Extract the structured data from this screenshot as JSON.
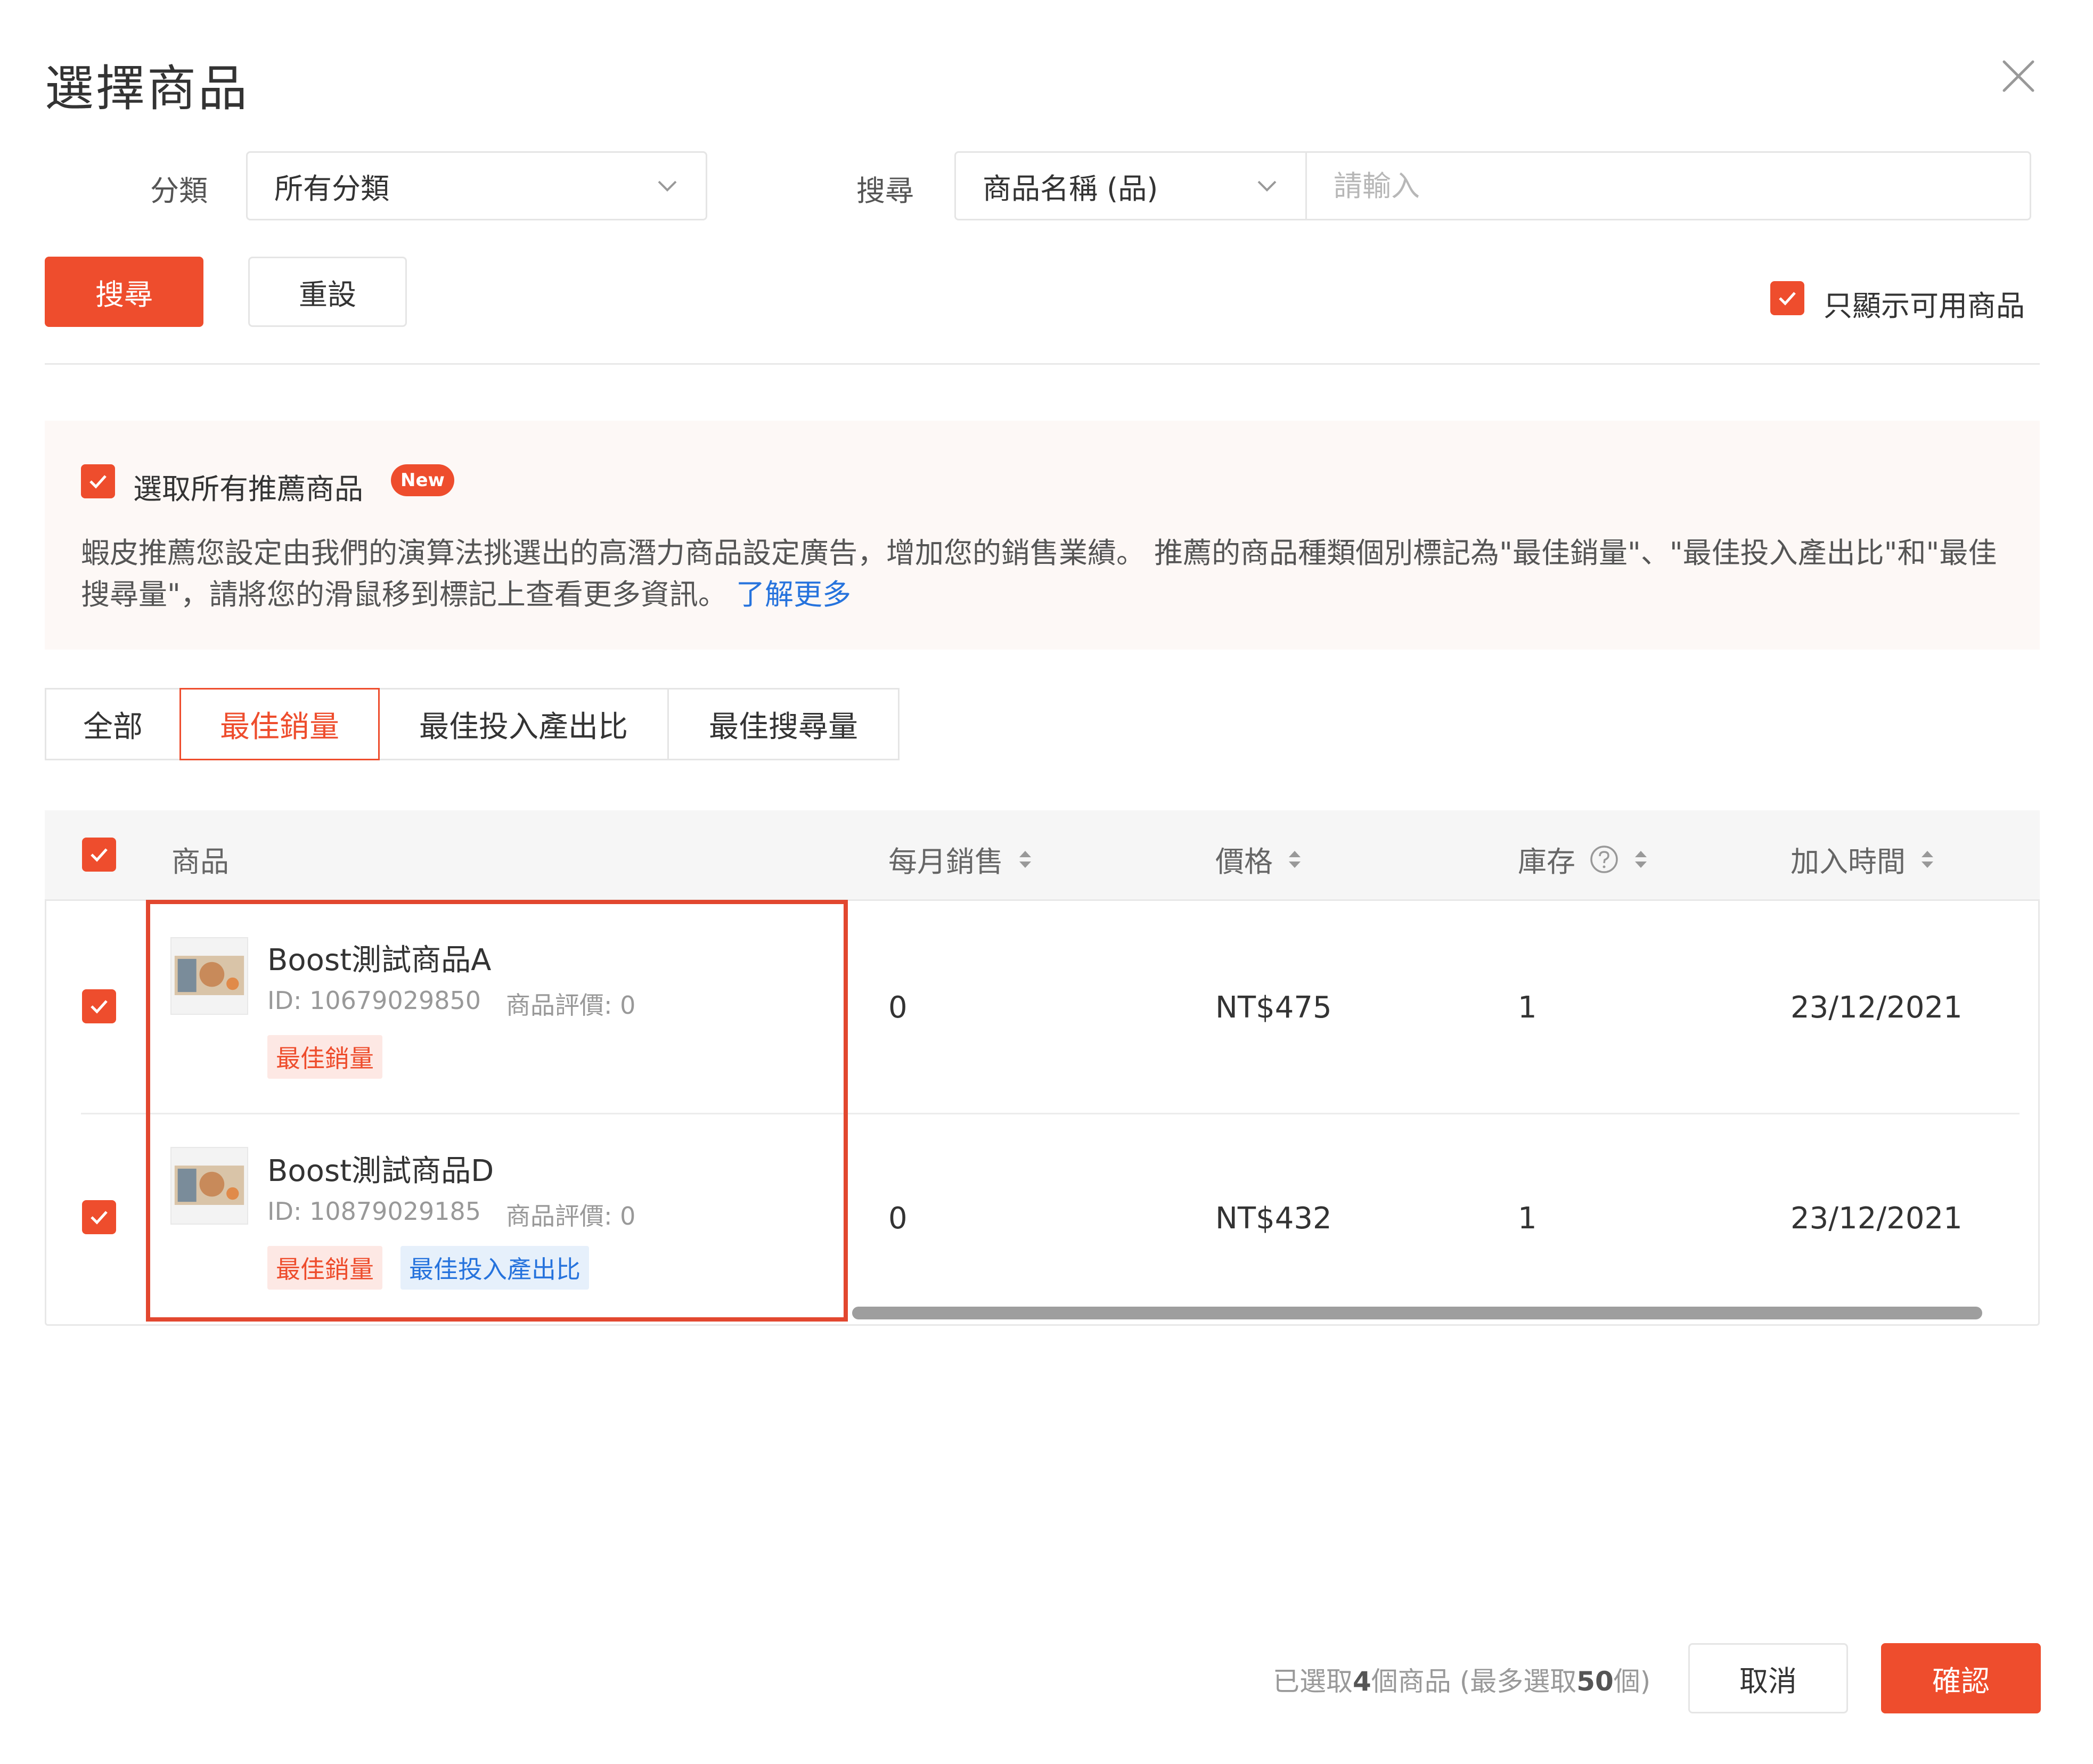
{
  "dialog": {
    "title": "選擇商品",
    "close_icon": "close-icon"
  },
  "filters": {
    "category_label": "分類",
    "category_value": "所有分類",
    "search_label": "搜尋",
    "search_field_value": "商品名稱 (品)",
    "search_placeholder": "請輸入",
    "search_button": "搜尋",
    "reset_button": "重設",
    "only_available_label": "只顯示可用商品",
    "only_available_checked": true
  },
  "recommend": {
    "select_all_label": "選取所有推薦商品",
    "select_all_checked": true,
    "new_badge": "New",
    "description": "蝦皮推薦您設定由我們的演算法挑選出的高潛力商品設定廣告，增加您的銷售業績。 推薦的商品種類個別標記為\"最佳銷量\"、\"最佳投入產出比\"和\"最佳搜尋量\"，請將您的滑鼠移到標記上查看更多資訊。",
    "learn_more": "了解更多"
  },
  "tabs": [
    {
      "label": "全部",
      "active": false
    },
    {
      "label": "最佳銷量",
      "active": true
    },
    {
      "label": "最佳投入產出比",
      "active": false
    },
    {
      "label": "最佳搜尋量",
      "active": false
    }
  ],
  "table": {
    "columns": {
      "product": "商品",
      "monthly_sales": "每月銷售",
      "price": "價格",
      "stock": "庫存",
      "added_time": "加入時間"
    },
    "rows": [
      {
        "checked": true,
        "name": "Boost測試商品A",
        "id_text": "ID: 10679029850",
        "rating_text": "商品評價: 0",
        "tags": [
          "最佳銷量"
        ],
        "monthly_sales": "0",
        "price": "NT$475",
        "stock": "1",
        "added_time": "23/12/2021"
      },
      {
        "checked": true,
        "name": "Boost測試商品D",
        "id_text": "ID: 10879029185",
        "rating_text": "商品評價: 0",
        "tags": [
          "最佳銷量",
          "最佳投入產出比"
        ],
        "monthly_sales": "0",
        "price": "NT$432",
        "stock": "1",
        "added_time": "23/12/2021"
      }
    ]
  },
  "footer": {
    "status_prefix": "已選取",
    "status_count": "4",
    "status_middle": "個商品 (最多選取",
    "status_max": "50",
    "status_suffix": "個)",
    "cancel_button": "取消",
    "confirm_button": "確認"
  },
  "colors": {
    "accent": "#ee4d2d",
    "link": "#2673dd",
    "highlight_border": "#e2472f"
  }
}
